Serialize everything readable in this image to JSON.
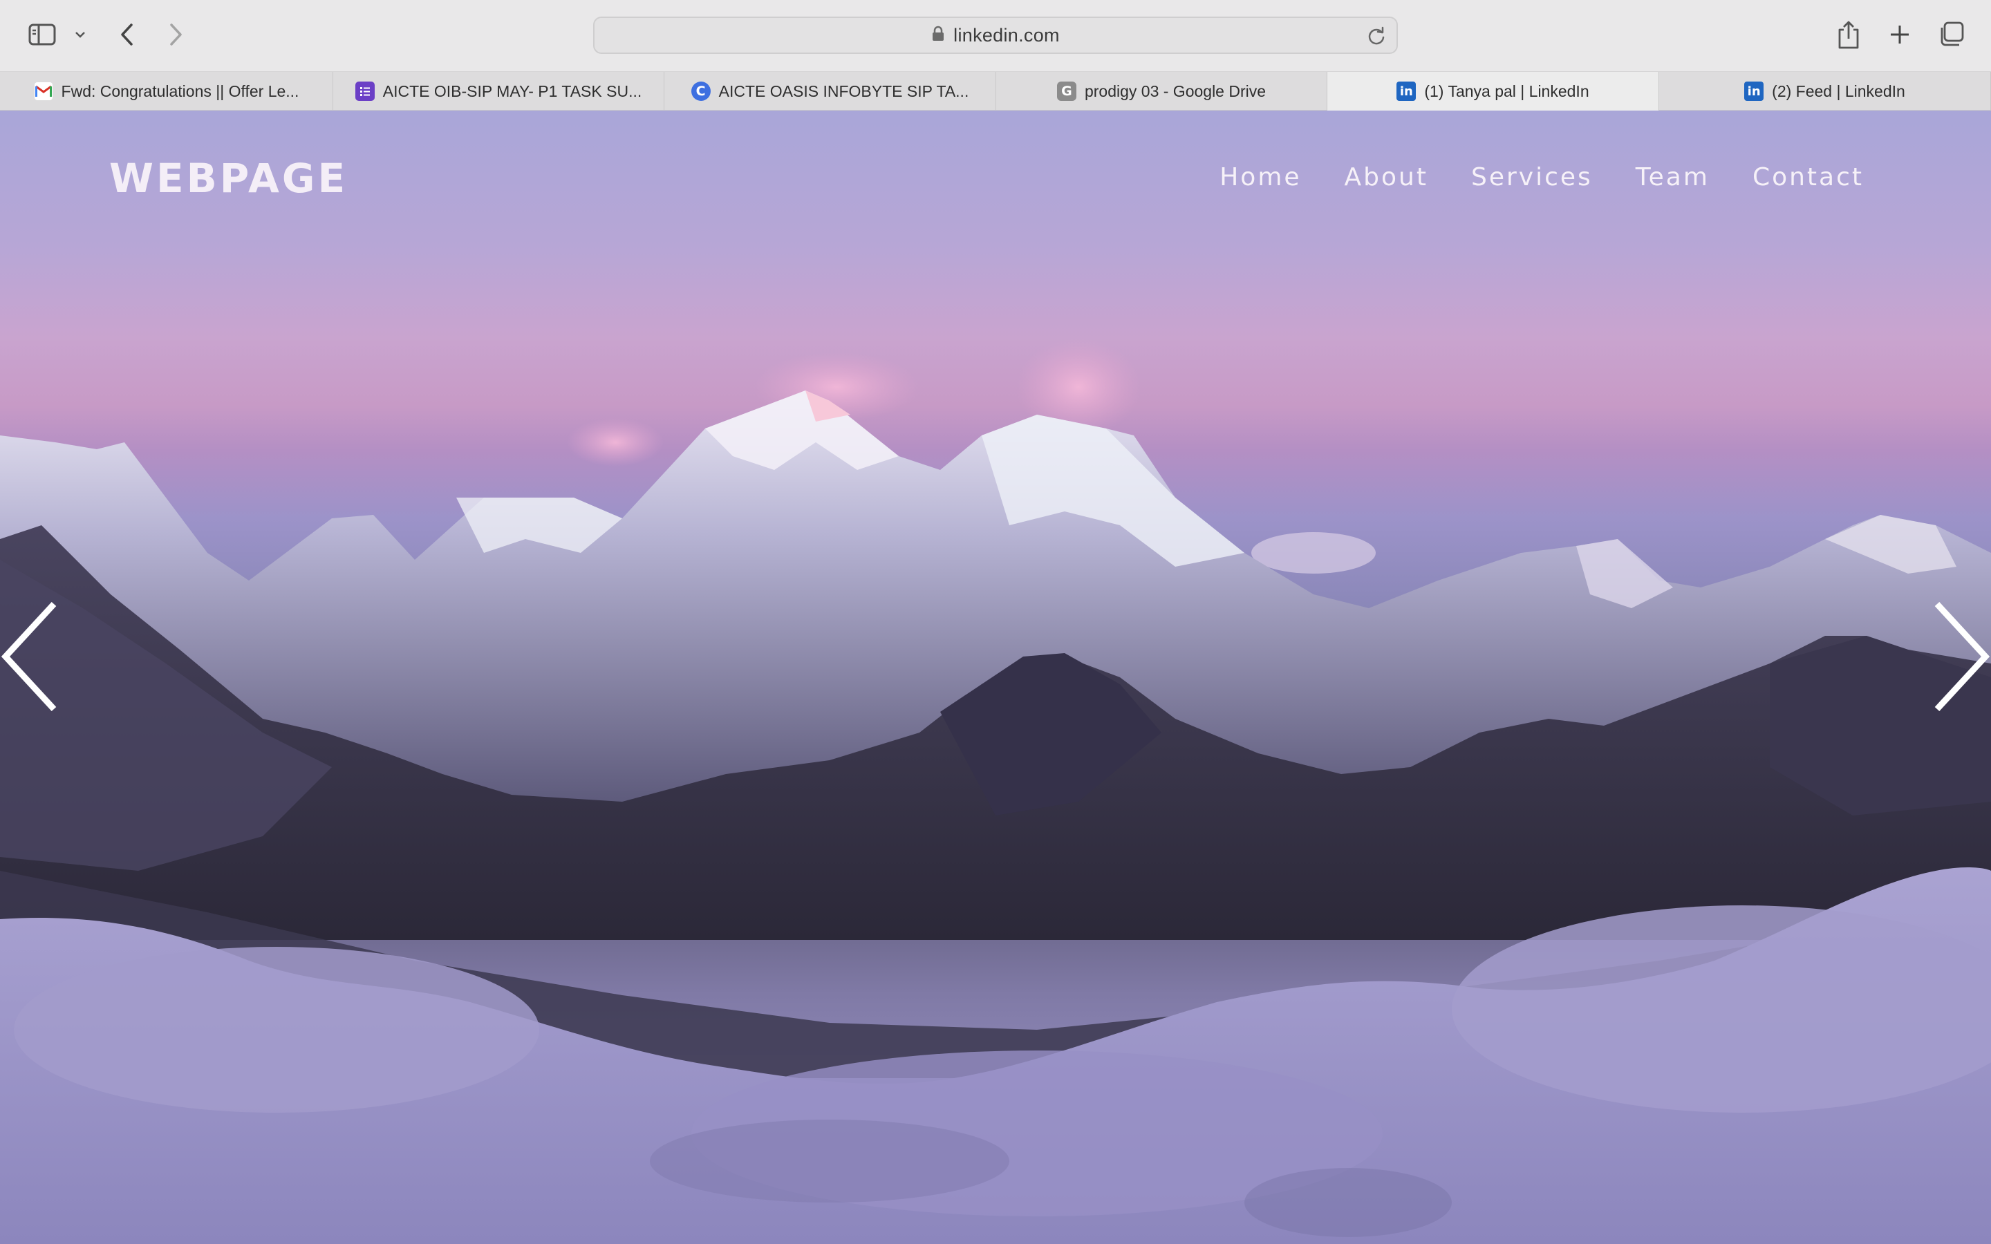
{
  "browser": {
    "address": "linkedin.com",
    "tabs": [
      {
        "label": "Fwd: Congratulations || Offer Le...",
        "icon": "gmail-icon"
      },
      {
        "label": "AICTE OIB-SIP MAY- P1 TASK SU...",
        "icon": "forms-icon"
      },
      {
        "label": "AICTE OASIS INFOBYTE SIP TA...",
        "icon": "c-logo-icon"
      },
      {
        "label": "prodigy 03 - Google Drive",
        "icon": "g-logo-icon"
      },
      {
        "label": "(1) Tanya pal | LinkedIn",
        "icon": "linkedin-icon",
        "active": true
      },
      {
        "label": "(2) Feed | LinkedIn",
        "icon": "linkedin-icon"
      }
    ]
  },
  "page": {
    "brand": "WEBPAGE",
    "nav": [
      "Home",
      "About",
      "Services",
      "Team",
      "Contact"
    ]
  },
  "colors": {
    "sky_top": "#a9a6d8",
    "sky_pink": "#c79ac6",
    "mountain_dark": "#2e2a3d",
    "cloud": "#9a93c8"
  }
}
